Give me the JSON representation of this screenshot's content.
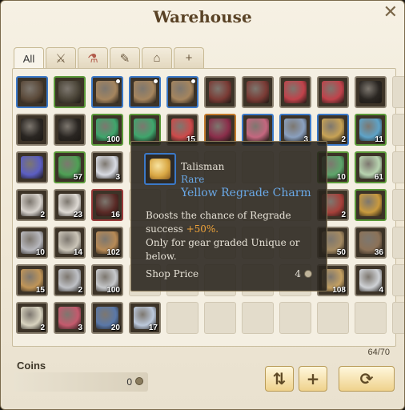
{
  "window": {
    "title": "Warehouse",
    "close_icon": "✕"
  },
  "tabs": [
    {
      "label": "All",
      "icon": "",
      "name": "tab-all",
      "active": true
    },
    {
      "label": "",
      "icon": "⚔",
      "name": "tab-weapons"
    },
    {
      "label": "",
      "icon": "⚗",
      "name": "tab-consumables"
    },
    {
      "label": "",
      "icon": "✎",
      "name": "tab-misc"
    },
    {
      "label": "",
      "icon": "⌂",
      "name": "tab-housing"
    },
    {
      "label": "",
      "icon": "+",
      "name": "tab-add"
    }
  ],
  "grid": {
    "columns": 11,
    "rows": 7,
    "slots": [
      {
        "c": "#5b4a3a",
        "g": "blue",
        "dot": false
      },
      {
        "c": "#4b4538",
        "g": "green"
      },
      {
        "c": "#a5855e",
        "g": "blue",
        "dot": true
      },
      {
        "c": "#a5855e",
        "g": "blue",
        "dot": true
      },
      {
        "c": "#a5855e",
        "g": "blue",
        "dot": true
      },
      {
        "c": "#7a3b35",
        "g": "gray"
      },
      {
        "c": "#7a3b35",
        "g": "gray"
      },
      {
        "c": "#c0424a",
        "g": "gray"
      },
      {
        "c": "#c0424a",
        "g": "gray"
      },
      {
        "c": "#2a2622",
        "g": "gray"
      },
      {
        "c": "",
        "g": ""
      },
      {
        "c": "#2a2622",
        "g": "gray"
      },
      {
        "c": "#2a2622",
        "g": "gray"
      },
      {
        "c": "#3fa56c",
        "g": "green",
        "n": "100"
      },
      {
        "c": "#3fa56c",
        "g": "green"
      },
      {
        "c": "#cc4a4a",
        "g": "gray",
        "n": "15"
      },
      {
        "c": "#8a2e4a",
        "g": "orange"
      },
      {
        "c": "#c4677f",
        "g": "blue"
      },
      {
        "c": "#8aa0bf",
        "g": "blue",
        "n": "3"
      },
      {
        "c": "#c7a255",
        "g": "blue",
        "n": "2"
      },
      {
        "c": "#5ea3c8",
        "g": "green",
        "n": "11"
      },
      {
        "c": "",
        "g": ""
      },
      {
        "c": "#5b5ec2",
        "g": "gray"
      },
      {
        "c": "#4fa055",
        "g": "green",
        "n": "57"
      },
      {
        "c": "#d8dbe3",
        "g": "gray",
        "n": "3"
      },
      {
        "c": "",
        "g": ""
      },
      {
        "c": "",
        "g": ""
      },
      {
        "c": "",
        "g": ""
      },
      {
        "c": "",
        "g": ""
      },
      {
        "c": "",
        "g": ""
      },
      {
        "c": "#5ea56b",
        "g": "green",
        "n": "10"
      },
      {
        "c": "#b8d4b0",
        "g": "green",
        "n": "61"
      },
      {
        "c": "",
        "g": ""
      },
      {
        "c": "#d7d2cc",
        "g": "gray",
        "n": "2"
      },
      {
        "c": "#dedad4",
        "g": "gray",
        "n": "23"
      },
      {
        "c": "#5a2a26",
        "g": "red",
        "n": "16"
      },
      {
        "c": "",
        "g": ""
      },
      {
        "c": "",
        "g": ""
      },
      {
        "c": "",
        "g": ""
      },
      {
        "c": "",
        "g": ""
      },
      {
        "c": "",
        "g": ""
      },
      {
        "c": "#a6403a",
        "g": "gray",
        "n": "2"
      },
      {
        "c": "#c99a3e",
        "g": "green"
      },
      {
        "c": "",
        "g": ""
      },
      {
        "c": "#b7b7bc",
        "g": "gray",
        "n": "10"
      },
      {
        "c": "#cbc5b8",
        "g": "gray",
        "n": "14"
      },
      {
        "c": "#b78a56",
        "g": "gray",
        "n": "102"
      },
      {
        "c": "",
        "g": ""
      },
      {
        "c": "",
        "g": ""
      },
      {
        "c": "",
        "g": ""
      },
      {
        "c": "",
        "g": ""
      },
      {
        "c": "",
        "g": ""
      },
      {
        "c": "#a48a62",
        "g": "gray",
        "n": "50"
      },
      {
        "c": "#8c7258",
        "g": "gray",
        "n": "36"
      },
      {
        "c": "",
        "g": ""
      },
      {
        "c": "#c09558",
        "g": "gray",
        "n": "15"
      },
      {
        "c": "#bfc1c6",
        "g": "gray",
        "n": "2"
      },
      {
        "c": "#c7c9cc",
        "g": "gray",
        "n": "100"
      },
      {
        "c": "",
        "g": ""
      },
      {
        "c": "",
        "g": ""
      },
      {
        "c": "",
        "g": ""
      },
      {
        "c": "",
        "g": ""
      },
      {
        "c": "",
        "g": ""
      },
      {
        "c": "#c4a062",
        "g": "gray",
        "n": "108"
      },
      {
        "c": "#cfd2d6",
        "g": "gray",
        "n": "4"
      },
      {
        "c": "",
        "g": ""
      },
      {
        "c": "#d8d3bf",
        "g": "gray",
        "n": "2"
      },
      {
        "c": "#c45a6d",
        "g": "gray",
        "n": "3"
      },
      {
        "c": "#5a78a8",
        "g": "gray",
        "n": "20"
      },
      {
        "c": "#bcc9dc",
        "g": "gray",
        "n": "17"
      },
      {
        "c": "",
        "g": ""
      },
      {
        "c": "",
        "g": ""
      },
      {
        "c": "",
        "g": ""
      },
      {
        "c": "",
        "g": ""
      },
      {
        "c": "",
        "g": ""
      },
      {
        "c": "",
        "g": ""
      },
      {
        "c": "",
        "g": ""
      }
    ]
  },
  "capacity": "64/70",
  "coins": {
    "label": "Coins",
    "value": "0",
    "icon": "coin-icon"
  },
  "buttons": [
    {
      "name": "sort-button",
      "icon": "⇅"
    },
    {
      "name": "expand-button",
      "icon": "+"
    },
    {
      "name": "refresh-button",
      "icon": "⟳"
    }
  ],
  "tooltip": {
    "category": "Talisman",
    "rarity": "Rare",
    "name": "Yellow Regrade Charm",
    "desc_1": "Boosts the chance of Regrade success ",
    "desc_highlight": "+50%.",
    "desc_2": "Only for gear graded Unique or below.",
    "price_label": "Shop Price",
    "price_value": "4"
  }
}
